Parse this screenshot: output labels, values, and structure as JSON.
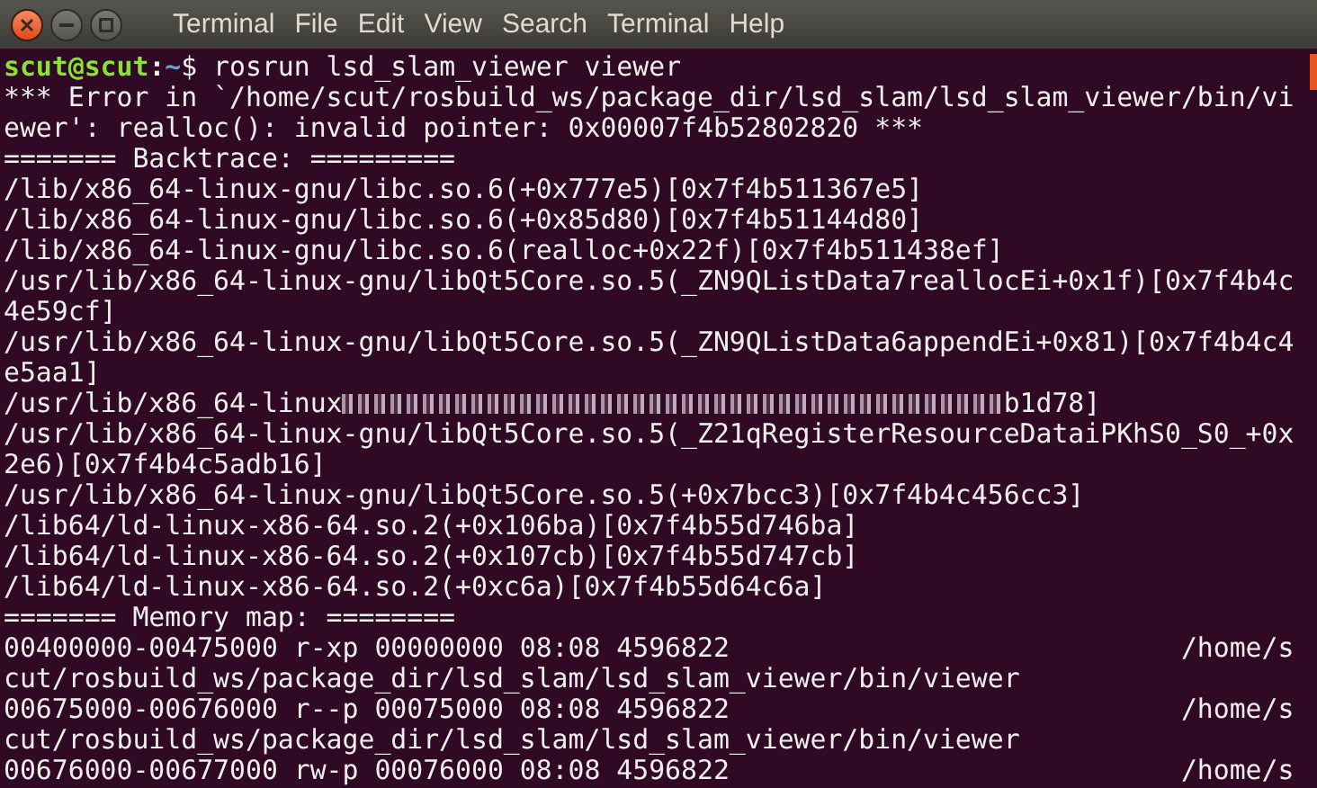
{
  "window": {
    "menu": [
      "Terminal",
      "File",
      "Edit",
      "View",
      "Search",
      "Terminal",
      "Help"
    ]
  },
  "terminal": {
    "lines": [
      {
        "kind": "prompt",
        "user": "scut@scut",
        "separator": ":",
        "path": "~",
        "command": "$ rosrun lsd_slam_viewer viewer"
      },
      {
        "kind": "text",
        "text": "*** Error in `/home/scut/rosbuild_ws/package_dir/lsd_slam/lsd_slam_viewer/bin/vi"
      },
      {
        "kind": "text",
        "text": "ewer': realloc(): invalid pointer: 0x00007f4b52802820 ***"
      },
      {
        "kind": "text",
        "text": "======= Backtrace: ========="
      },
      {
        "kind": "text",
        "text": "/lib/x86_64-linux-gnu/libc.so.6(+0x777e5)[0x7f4b511367e5]"
      },
      {
        "kind": "text",
        "text": "/lib/x86_64-linux-gnu/libc.so.6(+0x85d80)[0x7f4b51144d80]"
      },
      {
        "kind": "text",
        "text": "/lib/x86_64-linux-gnu/libc.so.6(realloc+0x22f)[0x7f4b511438ef]"
      },
      {
        "kind": "text",
        "text": "/usr/lib/x86_64-linux-gnu/libQt5Core.so.5(_ZN9QListData7reallocEi+0x1f)[0x7f4b4c"
      },
      {
        "kind": "text",
        "text": "4e59cf]"
      },
      {
        "kind": "text",
        "text": "/usr/lib/x86_64-linux-gnu/libQt5Core.so.5(_ZN9QListData6appendEi+0x81)[0x7f4b4c4"
      },
      {
        "kind": "text",
        "text": "e5aa1]"
      },
      {
        "kind": "glitch",
        "before": "/usr/lib/x86_64-linux",
        "after": "b1d78]"
      },
      {
        "kind": "text",
        "text": "/usr/lib/x86_64-linux-gnu/libQt5Core.so.5(_Z21qRegisterResourceDataiPKhS0_S0_+0x"
      },
      {
        "kind": "text",
        "text": "2e6)[0x7f4b4c5adb16]"
      },
      {
        "kind": "text",
        "text": "/usr/lib/x86_64-linux-gnu/libQt5Core.so.5(+0x7bcc3)[0x7f4b4c456cc3]"
      },
      {
        "kind": "text",
        "text": "/lib64/ld-linux-x86-64.so.2(+0x106ba)[0x7f4b55d746ba]"
      },
      {
        "kind": "text",
        "text": "/lib64/ld-linux-x86-64.so.2(+0x107cb)[0x7f4b55d747cb]"
      },
      {
        "kind": "text",
        "text": "/lib64/ld-linux-x86-64.so.2(+0xc6a)[0x7f4b55d64c6a]"
      },
      {
        "kind": "text",
        "text": "======= Memory map: ========"
      },
      {
        "kind": "text",
        "text": "00400000-00475000 r-xp 00000000 08:08 4596822                            /home/s"
      },
      {
        "kind": "text",
        "text": "cut/rosbuild_ws/package_dir/lsd_slam/lsd_slam_viewer/bin/viewer"
      },
      {
        "kind": "text",
        "text": "00675000-00676000 r--p 00075000 08:08 4596822                            /home/s"
      },
      {
        "kind": "text",
        "text": "cut/rosbuild_ws/package_dir/lsd_slam/lsd_slam_viewer/bin/viewer"
      },
      {
        "kind": "text",
        "text": "00676000-00677000 rw-p 00076000 08:08 4596822                            /home/s"
      }
    ]
  }
}
